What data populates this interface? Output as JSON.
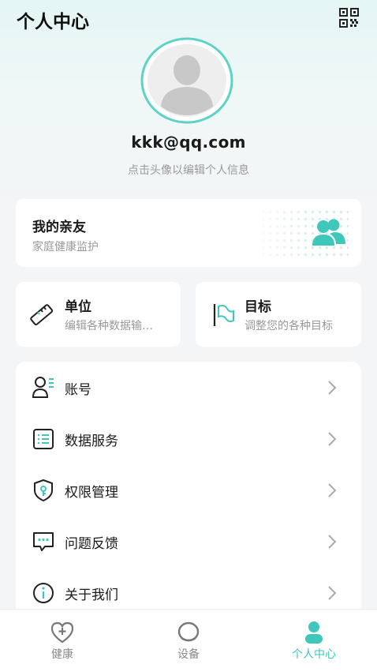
{
  "header": {
    "title": "个人中心",
    "qr_icon": "qr-code-icon"
  },
  "profile": {
    "avatar_icon": "avatar-placeholder-icon",
    "email": "kkk@qq.com",
    "hint": "点击头像以编辑个人信息"
  },
  "family": {
    "title": "我的亲友",
    "subtitle": "家庭健康监护",
    "icon": "users-icon"
  },
  "unit": {
    "title": "单位",
    "subtitle": "编辑各种数据输…",
    "icon": "ruler-icon"
  },
  "goal": {
    "title": "目标",
    "subtitle": "调整您的各种目标",
    "icon": "flag-icon"
  },
  "menu": {
    "items": [
      {
        "label": "账号",
        "icon": "account-icon"
      },
      {
        "label": "数据服务",
        "icon": "data-list-icon"
      },
      {
        "label": "权限管理",
        "icon": "shield-key-icon"
      },
      {
        "label": "问题反馈",
        "icon": "feedback-chat-icon"
      },
      {
        "label": "关于我们",
        "icon": "info-icon"
      }
    ]
  },
  "tabbar": {
    "tabs": [
      {
        "label": "健康",
        "icon": "heart-plus-icon",
        "active": false
      },
      {
        "label": "设备",
        "icon": "device-ring-icon",
        "active": false
      },
      {
        "label": "个人中心",
        "icon": "person-icon",
        "active": true
      }
    ]
  },
  "colors": {
    "accent": "#40c7bc",
    "text_primary": "#1a1a1a",
    "text_secondary": "#999999",
    "background": "#f3f5f6"
  }
}
